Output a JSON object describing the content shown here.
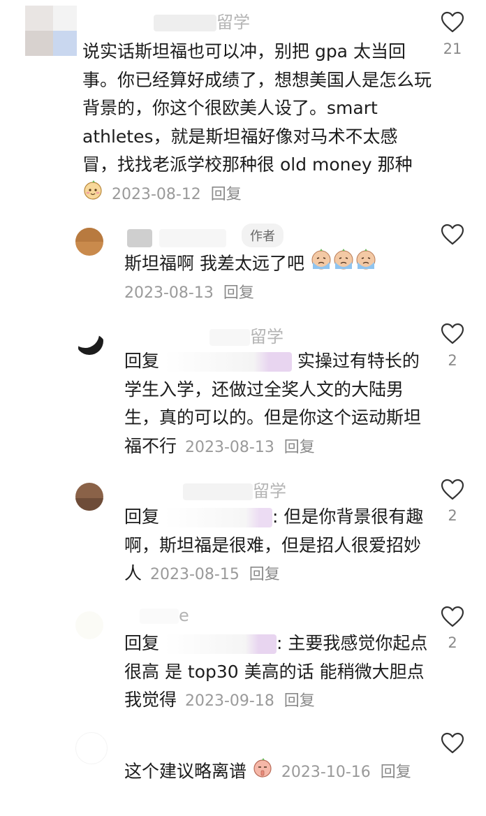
{
  "comments": [
    {
      "name_suffix": "留学",
      "text": "说实话斯坦福也可以冲，别把 gpa 太当回事。你已经算好成绩了，想想美国人是怎么玩背景的，你这个很欧美人设了。smart athletes，就是斯坦福好像对马术不太感冒，找找老派学校那种很 old money 那种",
      "date": "2023-08-12",
      "reply_label": "回复",
      "likes": "21",
      "emoji": "blush-face-emoji"
    },
    {
      "author_tag": "作者",
      "text": "斯坦福啊 我差太远了吧",
      "date": "2023-08-13",
      "reply_label": "回复",
      "likes": "",
      "emoji": "crying-face-emoji"
    },
    {
      "name_suffix": "留学",
      "reply_prefix": "回复",
      "text": "实操过有特长的学生入学，还做过全奖人文的大陆男生，真的可以的。但是你这个运动斯坦福不行",
      "date": "2023-08-13",
      "reply_label": "回复",
      "likes": "2"
    },
    {
      "name_suffix": "留学",
      "reply_prefix": "回复",
      "text": ": 但是你背景很有趣啊，斯坦福是很难，但是招人很爱招妙人",
      "date": "2023-08-15",
      "reply_label": "回复",
      "likes": "2"
    },
    {
      "name_suffix": "e",
      "reply_prefix": "回复",
      "text": ": 主要我感觉你起点很高 是 top30 美高的话 能稍微大胆点我觉得",
      "date": "2023-09-18",
      "reply_label": "回复",
      "likes": "2"
    },
    {
      "text": "这个建议略离谱",
      "date": "2023-10-16",
      "reply_label": "回复",
      "likes": "",
      "emoji": "shush-face-emoji"
    }
  ],
  "colors": {
    "heart_stroke": "#333333",
    "meta_text": "#9a9a9a",
    "mention_highlight": "#e8d5f0"
  }
}
